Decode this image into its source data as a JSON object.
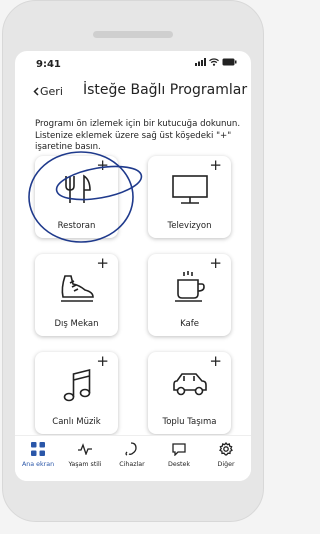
{
  "status": {
    "time": "9:41"
  },
  "nav": {
    "back_label": "Geri",
    "title": "İsteğe Bağlı Programlar"
  },
  "description": "Programı ön izlemek için bir kutucuğa dokunun. Listenize eklemek üzere sağ üst köşedeki \"+\" işaretine basın.",
  "tiles": [
    {
      "label": "Restoran",
      "icon": "fork-knife-icon"
    },
    {
      "label": "Televizyon",
      "icon": "tv-icon"
    },
    {
      "label": "Dış Mekan",
      "icon": "shoe-icon"
    },
    {
      "label": "Kafe",
      "icon": "coffee-cup-icon"
    },
    {
      "label": "Canlı Müzik",
      "icon": "music-note-icon"
    },
    {
      "label": "Toplu Taşıma",
      "icon": "car-icon"
    }
  ],
  "add_symbol": "+",
  "tabbar": [
    {
      "label": "Ana ekran",
      "icon": "grid-icon",
      "active": true
    },
    {
      "label": "Yaşam stili",
      "icon": "pulse-icon",
      "active": false
    },
    {
      "label": "Cihazlar",
      "icon": "hearing-aid-icon",
      "active": false
    },
    {
      "label": "Destek",
      "icon": "chat-icon",
      "active": false
    },
    {
      "label": "Diğer",
      "icon": "gear-icon",
      "active": false
    }
  ],
  "colors": {
    "accent": "#2a56a8",
    "annotation": "#1f3a8c"
  }
}
